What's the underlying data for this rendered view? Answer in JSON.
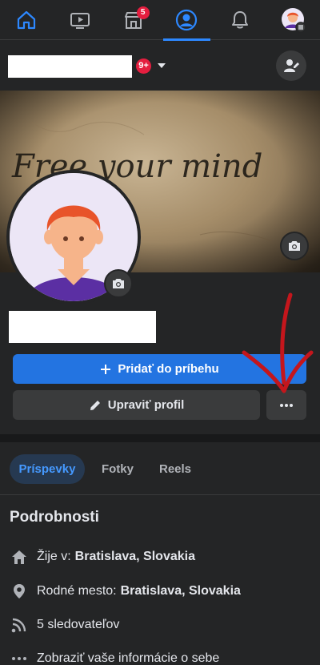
{
  "nav": {
    "items": [
      {
        "name": "home",
        "icon": "home-icon",
        "badge": ""
      },
      {
        "name": "watch",
        "icon": "video-icon",
        "badge": ""
      },
      {
        "name": "marketplace",
        "icon": "store-icon",
        "badge": "5"
      },
      {
        "name": "profile",
        "icon": "profile-icon",
        "badge": ""
      },
      {
        "name": "notifications",
        "icon": "bell-icon",
        "badge": ""
      },
      {
        "name": "menu",
        "icon": "avatar-menu-icon",
        "badge": ""
      }
    ],
    "active": "profile"
  },
  "header": {
    "notification_count": "9+"
  },
  "cover": {
    "text": "Free your mind"
  },
  "buttons": {
    "add_story": "Pridať do príbehu",
    "edit_profile": "Upraviť profil"
  },
  "tabs": [
    {
      "label": "Príspevky",
      "active": true
    },
    {
      "label": "Fotky",
      "active": false
    },
    {
      "label": "Reels",
      "active": false
    }
  ],
  "details": {
    "title": "Podrobnosti",
    "lives_label": "Žije v:",
    "lives_value": "Bratislava, Slovakia",
    "hometown_label": "Rodné mesto:",
    "hometown_value": "Bratislava, Slovakia",
    "followers": "5 sledovateľov",
    "about": "Zobraziť vaše informácie o sebe"
  },
  "colors": {
    "accent": "#2374e1",
    "active_tab_bg": "#263951",
    "badge": "#e41e3f",
    "annotation_arrow": "#c4161c"
  }
}
